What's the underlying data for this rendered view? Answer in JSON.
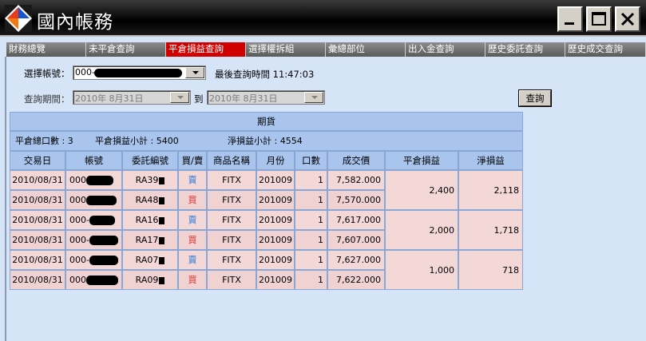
{
  "window": {
    "title": "國內帳務",
    "minimize_label": "_",
    "maximize_label": "□",
    "close_label": "×"
  },
  "tabs": [
    {
      "label": "財務總覽",
      "active": false
    },
    {
      "label": "未平倉查詢",
      "active": false
    },
    {
      "label": "平倉損益查詢",
      "active": true
    },
    {
      "label": "選擇權拆組",
      "active": false
    },
    {
      "label": "彙總部位",
      "active": false
    },
    {
      "label": "出入金查詢",
      "active": false
    },
    {
      "label": "歷史委託查詢",
      "active": false
    },
    {
      "label": "歷史成交查詢",
      "active": false
    }
  ],
  "filters": {
    "account_label": "選擇帳號：",
    "account_value": "000-",
    "last_query_label": "最後查詢時間",
    "last_query_time": "11:47:03",
    "period_label": "查詢期間：",
    "period_from": "2010年  8月31日",
    "period_to_label": "到",
    "period_to": "2010年  8月31日",
    "query_button": "查詢"
  },
  "grid": {
    "title": "期貨",
    "summary": {
      "closed_count": "平倉總口數 : 3",
      "closed_pl": "平倉損益小計 : 5400",
      "net_pl": "淨損益小計 : 4554"
    },
    "columns": [
      "交易日",
      "帳號",
      "委託編號",
      "買/賣",
      "商品名稱",
      "月份",
      "口數",
      "成交價",
      "平倉損益",
      "淨損益"
    ],
    "rows": [
      {
        "date": "2010/08/31",
        "account": "000",
        "order": "RA39",
        "side": "賣",
        "side_type": "sell",
        "product": "FITX",
        "month": "201009",
        "qty": "1",
        "price": "7,582.000"
      },
      {
        "date": "2010/08/31",
        "account": "000",
        "order": "RA48",
        "side": "買",
        "side_type": "buy",
        "product": "FITX",
        "month": "201009",
        "qty": "1",
        "price": "7,570.000"
      },
      {
        "date": "2010/08/31",
        "account": "000-",
        "order": "RA16",
        "side": "賣",
        "side_type": "sell",
        "product": "FITX",
        "month": "201009",
        "qty": "1",
        "price": "7,617.000"
      },
      {
        "date": "2010/08/31",
        "account": "000-",
        "order": "RA17",
        "side": "買",
        "side_type": "buy",
        "product": "FITX",
        "month": "201009",
        "qty": "1",
        "price": "7,607.000"
      },
      {
        "date": "2010/08/31",
        "account": "000-",
        "order": "RA07",
        "side": "賣",
        "side_type": "sell",
        "product": "FITX",
        "month": "201009",
        "qty": "1",
        "price": "7,627.000"
      },
      {
        "date": "2010/08/31",
        "account": "000",
        "order": "RA09",
        "side": "買",
        "side_type": "buy",
        "product": "FITX",
        "month": "201009",
        "qty": "1",
        "price": "7,622.000"
      }
    ],
    "pairs": [
      {
        "closed_pl": "2,400",
        "net_pl": "2,118"
      },
      {
        "closed_pl": "2,000",
        "net_pl": "1,718"
      },
      {
        "closed_pl": "1,000",
        "net_pl": "718"
      }
    ]
  },
  "colors": {
    "sell": "#e0302a",
    "buy": "#2d7bd6",
    "active_tab": "#d00000",
    "header_band": "#a9c5ee",
    "row_bg": "#f4d8d8"
  }
}
